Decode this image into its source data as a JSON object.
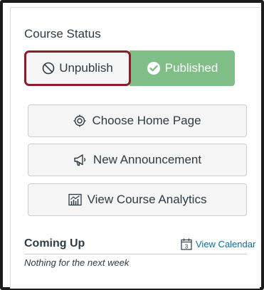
{
  "course_status": {
    "title": "Course Status",
    "unpublish_label": "Unpublish",
    "published_label": "Published"
  },
  "actions": {
    "choose_home_page": "Choose Home Page",
    "new_announcement": "New Announcement",
    "view_course_analytics": "View Course Analytics"
  },
  "coming_up": {
    "title": "Coming Up",
    "view_calendar": "View Calendar",
    "calendar_day": "3",
    "empty_message": "Nothing for the next week"
  },
  "icons": {
    "unpublish": "cancel-circle-icon",
    "published": "check-circle-icon",
    "home": "target-icon",
    "announcement": "megaphone-icon",
    "analytics": "analytics-icon",
    "calendar": "calendar-icon"
  },
  "colors": {
    "published_bg": "#7fbf87",
    "highlight_border": "#8c1c2b",
    "link": "#0770a3",
    "text": "#2d3b45"
  }
}
